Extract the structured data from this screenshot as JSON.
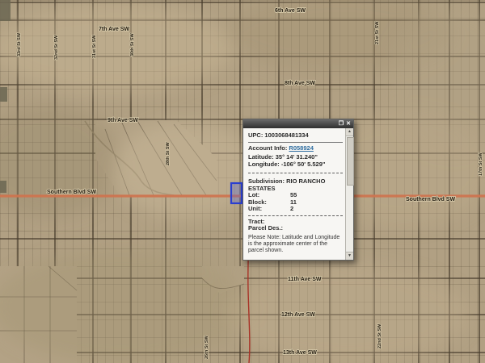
{
  "map": {
    "labels": [
      {
        "text": "6th Ave SW"
      },
      {
        "text": "7th Ave SW"
      },
      {
        "text": "8th Ave SW"
      },
      {
        "text": "9th Ave SW"
      },
      {
        "text": "11th Ave SW"
      },
      {
        "text": "12th Ave SW"
      },
      {
        "text": "13th Ave SW"
      },
      {
        "text": "Southern Blvd SW"
      },
      {
        "text": "Southern Blvd SW"
      },
      {
        "text": "33rd St SW"
      },
      {
        "text": "32nd St SW"
      },
      {
        "text": "31st St SW"
      },
      {
        "text": "30th St SW"
      },
      {
        "text": "28th St SW"
      },
      {
        "text": "26th St SW"
      },
      {
        "text": "22nd St SW"
      },
      {
        "text": "21st St SW"
      },
      {
        "text": "17th St SW"
      }
    ],
    "colors": {
      "terrain": "#b1a083",
      "road_orange": "#cf7450",
      "route_red": "#a83226",
      "selected_parcel_blue": "#2b3fd0"
    }
  },
  "popup": {
    "titlebar": {
      "restore": "❐",
      "close": "✕"
    },
    "upc": "UPC: 1003068481334",
    "account_label": "Account Info:",
    "account_link": "R058924",
    "latitude": "Latitude: 35° 14' 31.240\"",
    "longitude": "Longitude: -106° 50' 5.529\"",
    "subdivision_label": "Subdivision:",
    "subdivision_value": "RIO RANCHO ESTATES",
    "lot_label": "Lot:",
    "lot_value": "55",
    "block_label": "Block:",
    "block_value": "11",
    "unit_label": "Unit:",
    "unit_value": "2",
    "tract_label": "Tract:",
    "parcel_des_label": "Parcel Des.:",
    "note": "Please Note: Latitude and Longitude is the approximate center of the parcel shown.",
    "scroll": {
      "up": "▲",
      "down": "▼"
    }
  }
}
